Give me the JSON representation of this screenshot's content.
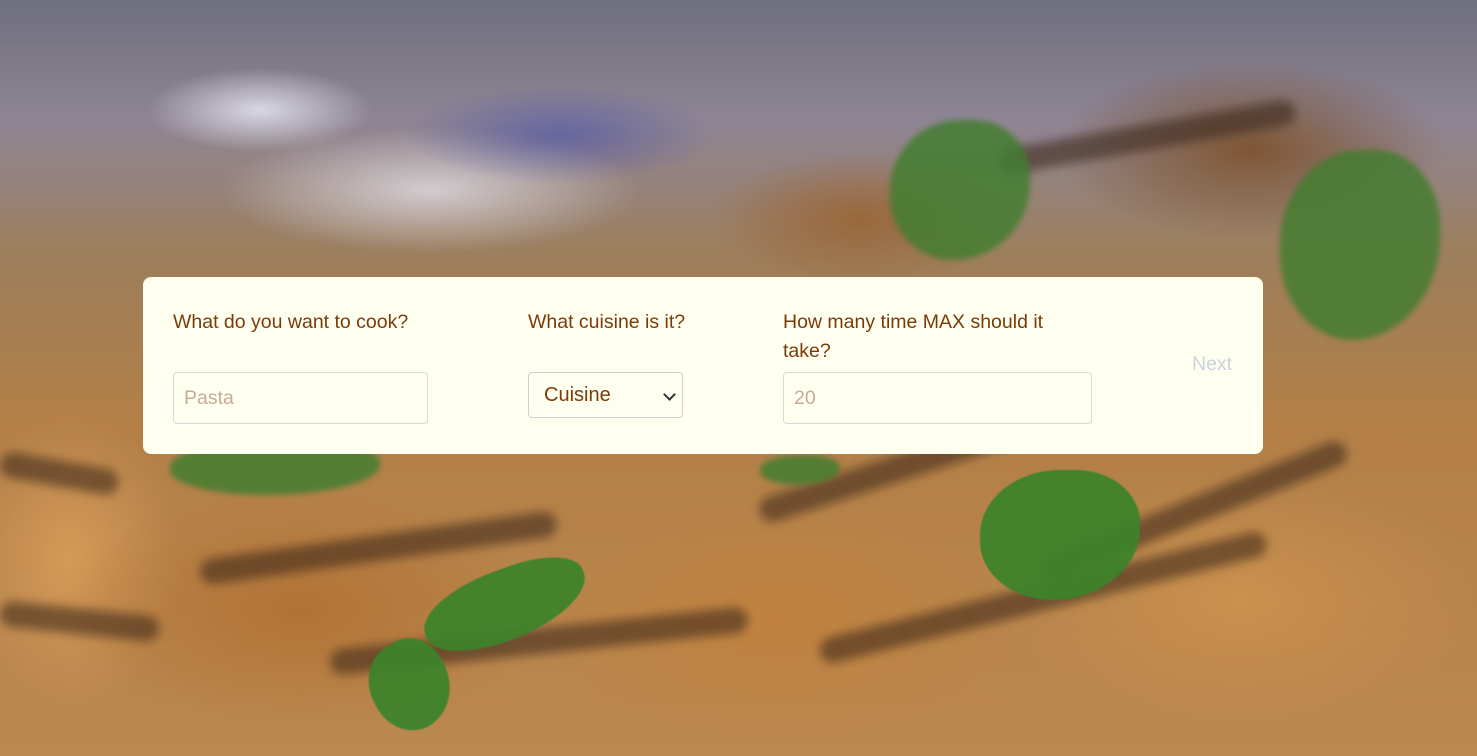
{
  "form": {
    "dish_label": "What do you want to cook?",
    "dish_placeholder": "Pasta",
    "dish_value": "",
    "cuisine_label": "What cuisine is it?",
    "cuisine_selected": "Cuisine",
    "time_label": "How many time MAX should it take?",
    "time_placeholder": "20",
    "time_value": "",
    "next_label": "Next"
  },
  "colors": {
    "card_background": "#fffff0",
    "label_text": "#7a3b0a",
    "placeholder_text": "#c9a995",
    "next_disabled": "#ccd3dd"
  },
  "background": {
    "description_icon": "grilled-food-photo"
  },
  "icons": {
    "select_arrow": "chevron-down-icon"
  }
}
